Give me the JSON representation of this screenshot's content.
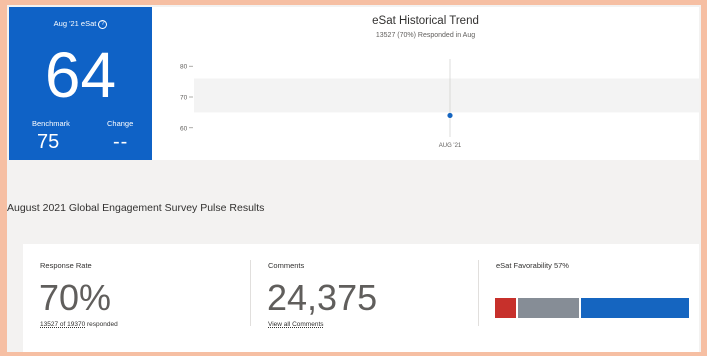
{
  "esat": {
    "title": "Aug '21 eSat",
    "info_icon": "?",
    "score": "64",
    "benchmark_label": "Benchmark",
    "benchmark_value": "75",
    "change_label": "Change",
    "change_value": "--"
  },
  "trend": {
    "title": "eSat Historical Trend",
    "subtitle": "13527 (70%) Responded in Aug"
  },
  "chart_data": {
    "type": "line",
    "title": "eSat Historical Trend",
    "subtitle": "13527 (70%) Responded in Aug",
    "categories": [
      "AUG '21"
    ],
    "series": [
      {
        "values": [
          64
        ]
      }
    ],
    "yticks": [
      "80",
      "70",
      "60"
    ],
    "ylim": [
      57,
      83
    ],
    "benchmark_band": [
      65,
      76
    ],
    "grid": false
  },
  "section": {
    "title": "August 2021 Global Engagement Survey Pulse Results"
  },
  "kpis": {
    "response_rate": {
      "label": "Response Rate",
      "value": "70%",
      "link_count": "13527 of 19370",
      "link_suffix": "responded"
    },
    "comments": {
      "label": "Comments",
      "value": "24,375",
      "link": "View all Comments"
    },
    "favorability": {
      "label": "eSat Favorability 57%",
      "segments": [
        {
          "name": "unfavorable",
          "fraction": 0.11,
          "color": "#c7302b"
        },
        {
          "name": "neutral",
          "fraction": 0.32,
          "color": "#868d96"
        },
        {
          "name": "favorable",
          "fraction": 0.57,
          "color": "#1565c0"
        }
      ]
    }
  },
  "colors": {
    "accent": "#0f62c6",
    "page_border": "#f6bfa3",
    "point": "#1565c0"
  }
}
